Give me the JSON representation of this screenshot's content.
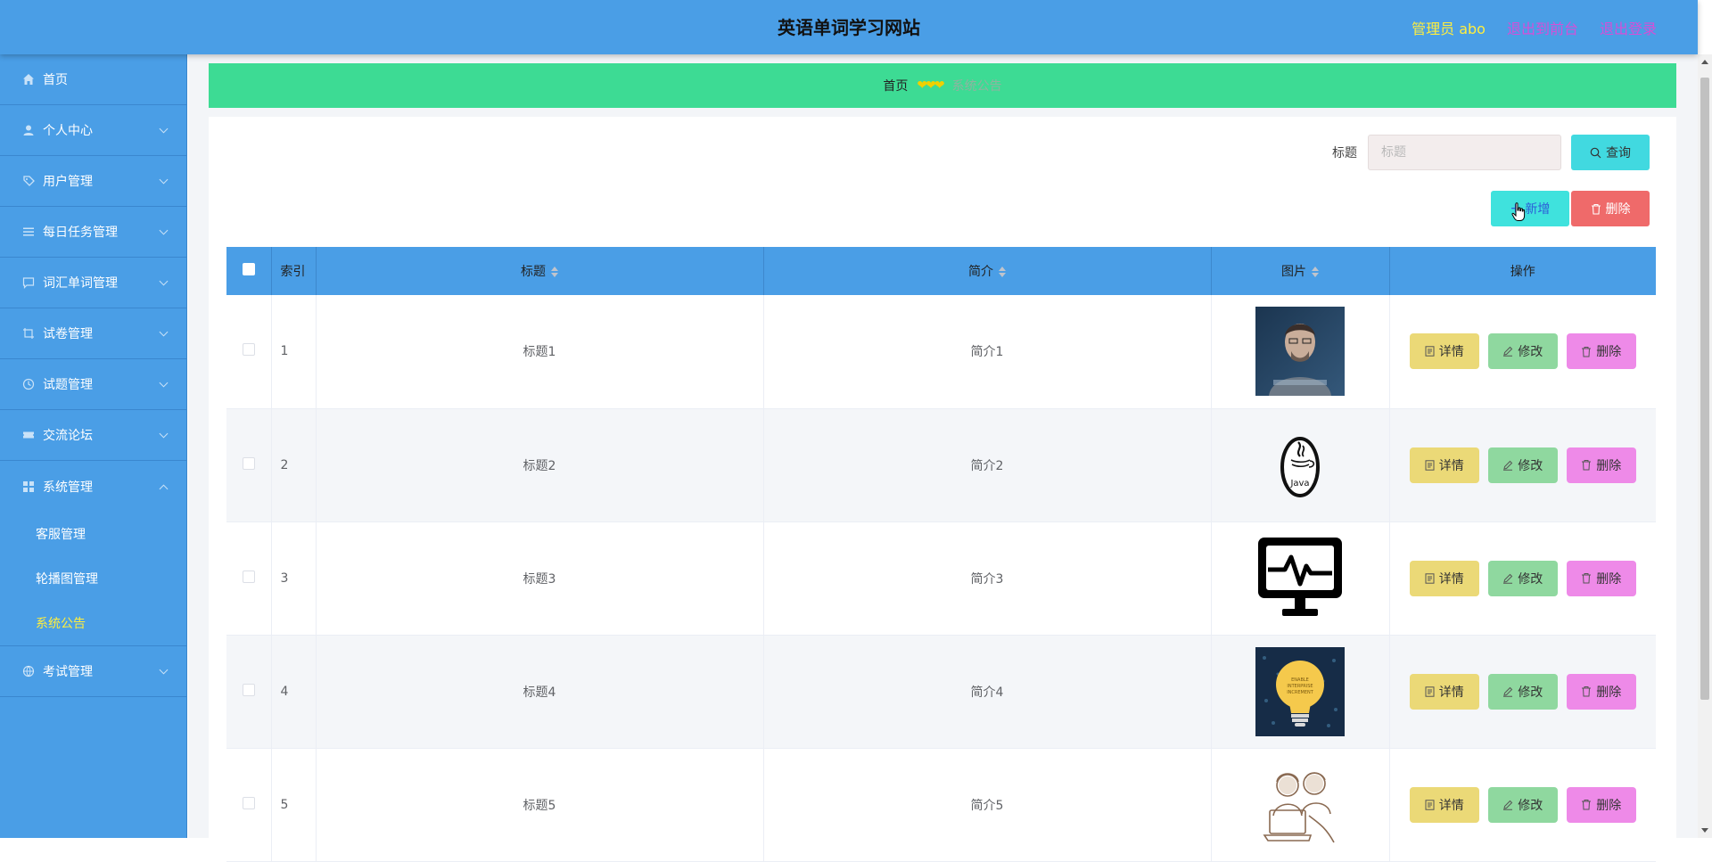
{
  "header": {
    "title": "英语单词学习网站",
    "admin": "管理员 abo",
    "to_front": "退出到前台",
    "logout": "退出登录"
  },
  "sidebar": {
    "items": [
      {
        "label": "首页",
        "icon": "home-icon"
      },
      {
        "label": "个人中心",
        "icon": "user-icon"
      },
      {
        "label": "用户管理",
        "icon": "tag-icon"
      },
      {
        "label": "每日任务管理",
        "icon": "list-icon"
      },
      {
        "label": "词汇单词管理",
        "icon": "chat-icon"
      },
      {
        "label": "试卷管理",
        "icon": "crop-icon"
      },
      {
        "label": "试题管理",
        "icon": "clock-icon"
      },
      {
        "label": "交流论坛",
        "icon": "ticket-icon"
      },
      {
        "label": "系统管理",
        "icon": "grid-icon"
      },
      {
        "label": "考试管理",
        "icon": "globe-icon"
      }
    ],
    "sub_items": [
      {
        "label": "客服管理"
      },
      {
        "label": "轮播图管理"
      },
      {
        "label": "系统公告"
      }
    ]
  },
  "breadcrumb": {
    "home": "首页",
    "separator": "❤❤❤",
    "current": "系统公告"
  },
  "search": {
    "label": "标题",
    "placeholder": "标题",
    "query_button": "查询"
  },
  "actions": {
    "add": "新增",
    "delete": "删除"
  },
  "table": {
    "headers": {
      "index": "索引",
      "title": "标题",
      "intro": "简介",
      "image": "图片",
      "ops": "操作"
    },
    "rows": [
      {
        "index": "1",
        "title": "标题1",
        "intro": "简介1",
        "image": "man-photo"
      },
      {
        "index": "2",
        "title": "标题2",
        "intro": "简介2",
        "image": "java-logo"
      },
      {
        "index": "3",
        "title": "标题3",
        "intro": "简介3",
        "image": "monitor-pulse-icon"
      },
      {
        "index": "4",
        "title": "标题4",
        "intro": "简介4",
        "image": "lightbulb-illustration"
      },
      {
        "index": "5",
        "title": "标题5",
        "intro": "简介5",
        "image": "two-people-sketch"
      }
    ],
    "op_labels": {
      "detail": "详情",
      "edit": "修改",
      "delete": "删除"
    }
  },
  "colors": {
    "header_bg": "#4a9ee6",
    "breadcrumb_bg": "#3ddb94",
    "admin_text": "#ffee3e",
    "link_text": "#d54fd8",
    "detail_btn": "#ebd977",
    "edit_btn": "#8fd89f",
    "delete_btn": "#ee8ae8"
  }
}
